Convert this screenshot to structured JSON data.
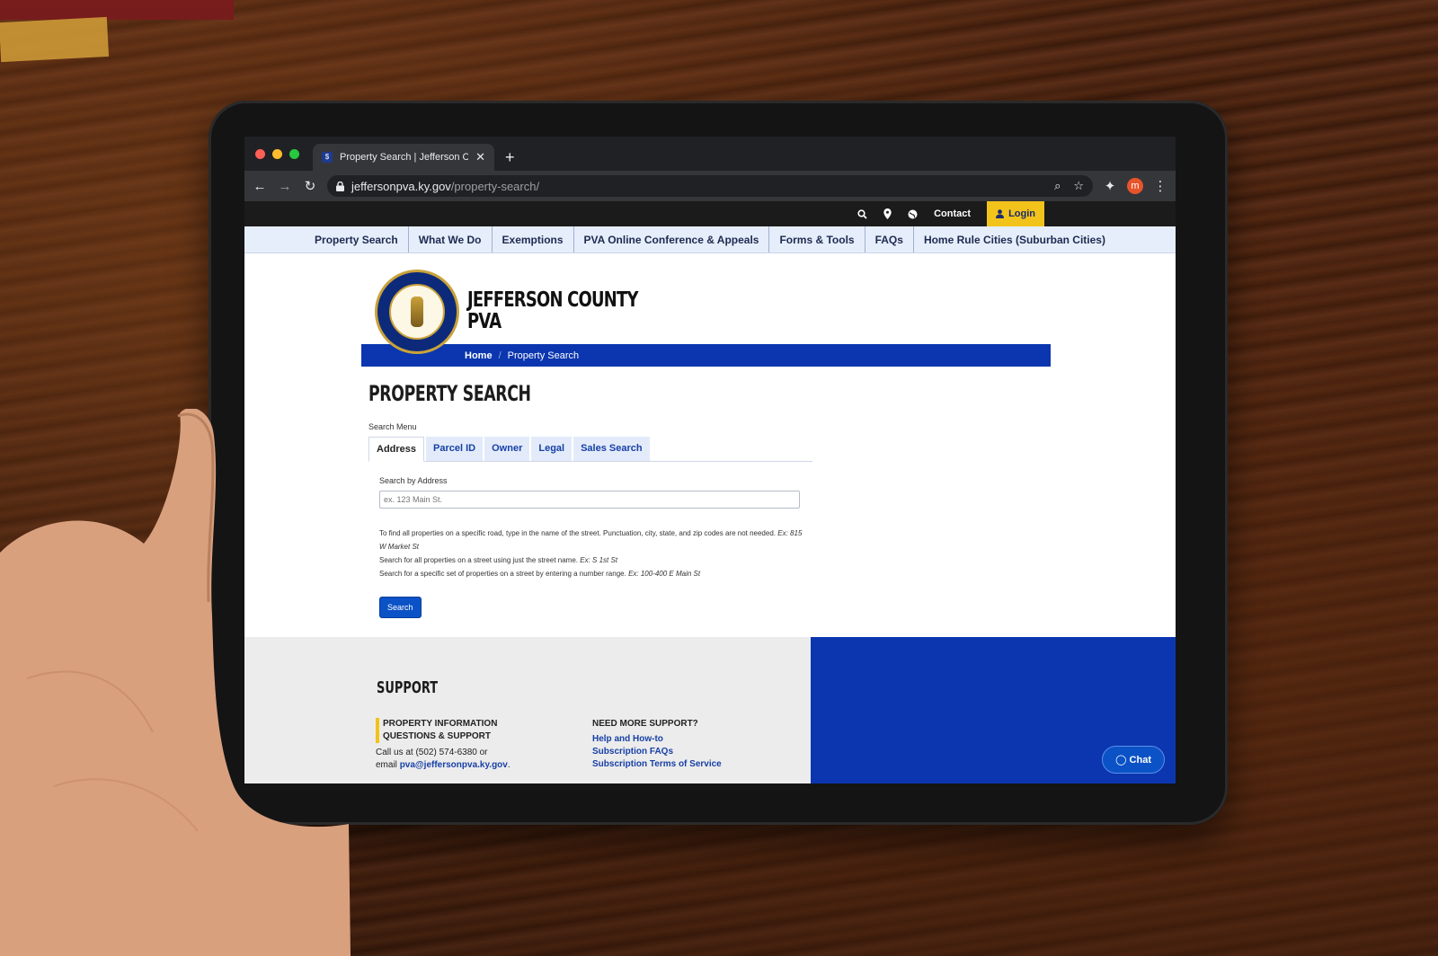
{
  "browser": {
    "tab_title": "Property Search | Jefferson Co",
    "tab_close": "✕",
    "new_tab": "+",
    "url_host": "jeffersonpva.ky.gov",
    "url_path": "/property-search/",
    "profile_initial": "m"
  },
  "utility_bar": {
    "contact": "Contact",
    "login": "Login"
  },
  "main_nav": [
    "Property Search",
    "What We Do",
    "Exemptions",
    "PVA Online Conference & Appeals",
    "Forms & Tools",
    "FAQs",
    "Home Rule Cities (Suburban Cities)"
  ],
  "header": {
    "brand_line1": "JEFFERSON COUNTY",
    "brand_line2": "PVA",
    "breadcrumb_home": "Home",
    "breadcrumb_sep": "/",
    "breadcrumb_current": "Property Search"
  },
  "content": {
    "page_title": "PROPERTY SEARCH",
    "search_menu_label": "Search Menu",
    "tabs": [
      "Address",
      "Parcel ID",
      "Owner",
      "Legal",
      "Sales Search"
    ],
    "field_label": "Search by Address",
    "field_placeholder": "ex. 123 Main St.",
    "help_line1": "To find all properties on a specific road, type in the name of the street. Punctuation, city, state, and zip codes are not needed.",
    "help_line1_example": "Ex: 815 W Market St",
    "help_line2": "Search for all properties on a street using just the street name.",
    "help_line2_example": "Ex: S 1st St",
    "help_line3": "Search for a specific set of properties on a street by entering a number range.",
    "help_line3_example": "Ex: 100-400 E Main St",
    "search_button": "Search"
  },
  "footer": {
    "title": "SUPPORT",
    "col1_heading_line1": "PROPERTY INFORMATION",
    "col1_heading_line2": "QUESTIONS & SUPPORT",
    "col1_call": "Call us at (502) 574-6380 or",
    "col1_email_prefix": "email",
    "col1_email": "pva@jeffersonpva.ky.gov",
    "col1_email_suffix": ".",
    "col2_heading": "NEED MORE SUPPORT?",
    "col2_links": [
      "Help and How-to",
      "Subscription FAQs",
      "Subscription Terms of Service"
    ],
    "chat_button": "Chat"
  },
  "colors": {
    "brand_blue": "#0b36b0",
    "login_yellow": "#f2c31a",
    "nav_bg": "#e6eefb",
    "search_button": "#0b52c6"
  },
  "icons": {
    "search": "search-icon",
    "location": "map-pin-icon",
    "language": "globe-icon",
    "user": "user-icon",
    "chat": "chat-bubble-icon",
    "lock": "lock-icon"
  }
}
